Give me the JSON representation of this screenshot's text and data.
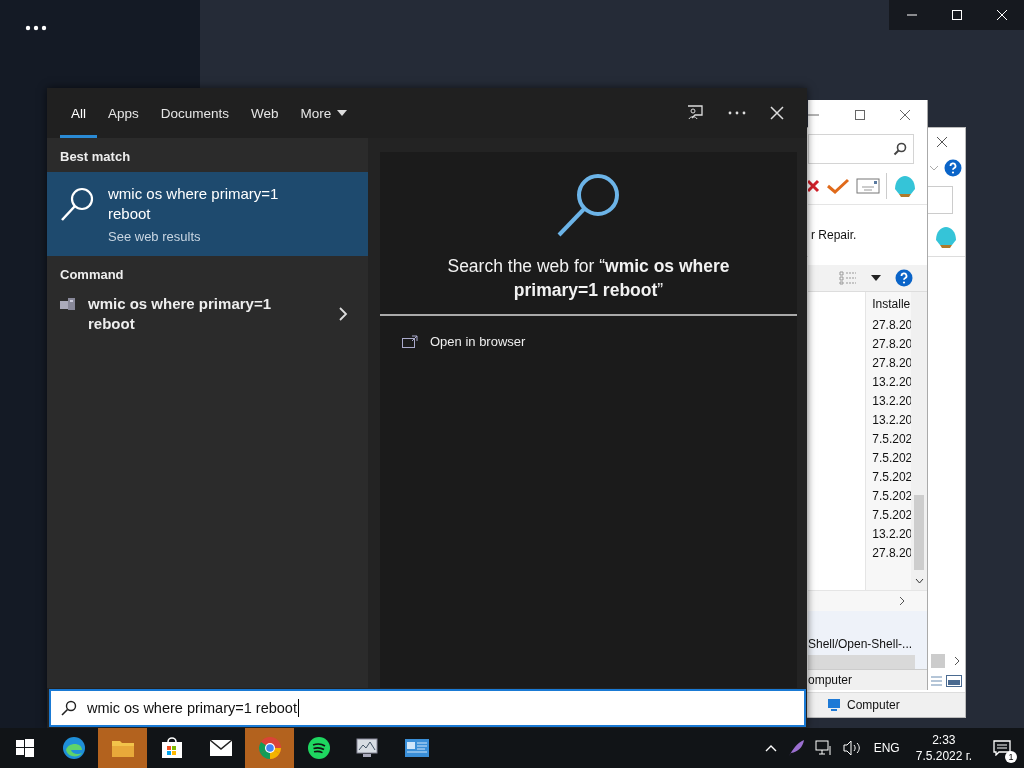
{
  "search_panel": {
    "tabs": [
      {
        "label": "All",
        "selected": true,
        "kind": "tab"
      },
      {
        "label": "Apps",
        "selected": false,
        "kind": "tab"
      },
      {
        "label": "Documents",
        "selected": false,
        "kind": "tab"
      },
      {
        "label": "Web",
        "selected": false,
        "kind": "tab"
      },
      {
        "label": "More",
        "selected": false,
        "kind": "menu"
      }
    ],
    "best_match": {
      "heading": "Best match",
      "title": "wmic os where primary=1 reboot",
      "subtitle": "See web results",
      "selected": true
    },
    "command": {
      "heading": "Command",
      "title": "wmic os where primary=1 reboot"
    },
    "preview": {
      "text": "Search the web for “**wmic os where primary=1 reboot**”",
      "action": "Open in browser"
    },
    "query": "wmic os where primary=1 reboot"
  },
  "front_window": {
    "message": "r Repair.",
    "column": "Installe",
    "rows": [
      "27.8.20",
      "27.8.20",
      "27.8.20",
      "13.2.20",
      "13.2.20",
      "13.2.20",
      "7.5.202",
      "7.5.202",
      "7.5.202",
      "7.5.202",
      "7.5.202",
      "13.2.20",
      "27.8.20"
    ],
    "link": "Shell/Open-Shell-...",
    "status": "omputer"
  },
  "back_window": {
    "status": "Computer"
  },
  "taskbar": {
    "apps": [
      {
        "kind": "edge",
        "highlighted": false
      },
      {
        "kind": "folder",
        "highlighted": true
      },
      {
        "kind": "store",
        "highlighted": false
      },
      {
        "kind": "mail",
        "highlighted": false
      },
      {
        "kind": "chrome",
        "highlighted": true
      },
      {
        "kind": "spotify",
        "highlighted": false
      },
      {
        "kind": "monitor",
        "highlighted": false
      },
      {
        "kind": "panel",
        "highlighted": false
      }
    ],
    "language": "ENG",
    "time": "2:33",
    "date": "7.5.2022 г.",
    "notifications": "1"
  }
}
